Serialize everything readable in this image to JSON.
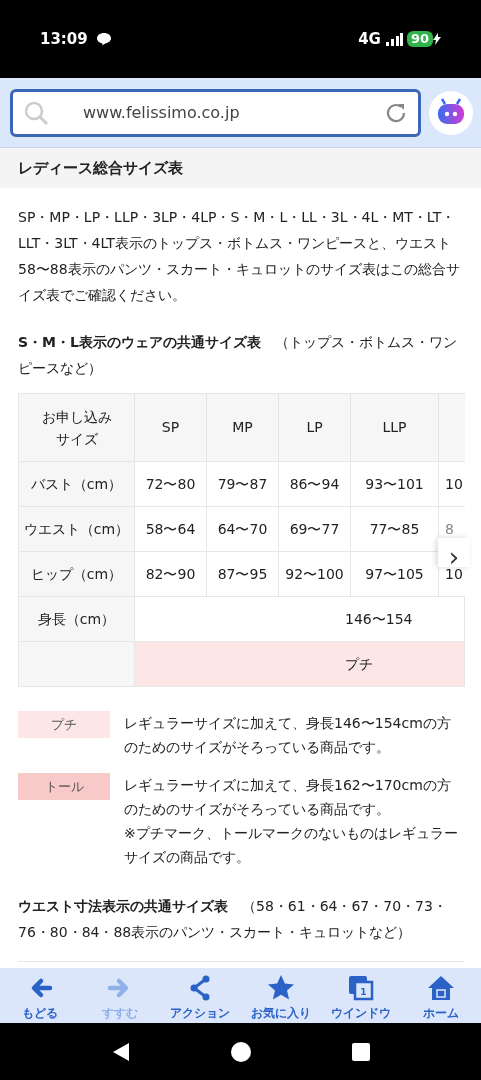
{
  "status_bar": {
    "time": "13:09",
    "network": "4G",
    "battery": "90"
  },
  "address_bar": {
    "url": "www.felissimo.co.jp"
  },
  "page_title": "レディース総合サイズ表",
  "intro": "SP・MP・LP・LLP・3LP・4LP・S・M・L・LL・3L・4L・MT・LT・LLT・3LT・4LT表示のトップス・ボトムス・ワンピースと、ウエスト58〜88表示のパンツ・スカート・キュロットのサイズ表はこの総合サイズ表でご確認ください。",
  "section_1": {
    "heading": "**S・M・L表示のウェアの共通サイズ表**　（トップス・ボトムス・ワンピースなど）"
  },
  "size_table": {
    "corner": [
      "お申し込み",
      "サイズ"
    ],
    "columns": [
      "SP",
      "MP",
      "LP",
      "LLP"
    ],
    "rows": [
      {
        "label": "バスト（cm）",
        "cells": [
          "72〜80",
          "79〜87",
          "86〜94",
          "93〜101",
          "10"
        ]
      },
      {
        "label": "ウエスト（cm）",
        "cells": [
          "58〜64",
          "64〜70",
          "69〜77",
          "77〜85",
          "8"
        ]
      },
      {
        "label": "ヒップ（cm）",
        "cells": [
          "82〜90",
          "87〜95",
          "92〜100",
          "97〜105",
          "10"
        ]
      }
    ],
    "span_rows": [
      {
        "label": "身長（cm）",
        "value": "146〜154"
      },
      {
        "value": "プチ",
        "color": "#fde6e6"
      }
    ],
    "scroll_arrow": "›"
  },
  "legend": [
    {
      "label": "プチ",
      "color": "#fde6e6",
      "text": "レギュラーサイズに加えて、身長146〜154cmの方のためのサイズがそろっている商品です。"
    },
    {
      "label": "トール",
      "color": "#f8c9c9",
      "text": "レギュラーサイズに加えて、身長162〜170cmの方のためのサイズがそろっている商品です。",
      "note": "※プチマーク、トールマークのないものはレギュラーサイズの商品です。"
    }
  ],
  "section_2": {
    "heading": "**ウエスト寸法表示の共通サイズ表**　（58・61・64・67・70・73・76・80・84・88表示のパンツ・スカート・キュロットなど）"
  },
  "toolbar": [
    {
      "kind": "back",
      "label": "もどる",
      "disabled": false
    },
    {
      "kind": "forward",
      "label": "すすむ",
      "disabled": true
    },
    {
      "kind": "share",
      "label": "アクション",
      "disabled": false
    },
    {
      "kind": "star",
      "label": "お気に入り",
      "disabled": false
    },
    {
      "kind": "window",
      "label": "ウインドウ",
      "count": "1",
      "disabled": false
    },
    {
      "kind": "home",
      "label": "ホーム",
      "disabled": false
    }
  ]
}
